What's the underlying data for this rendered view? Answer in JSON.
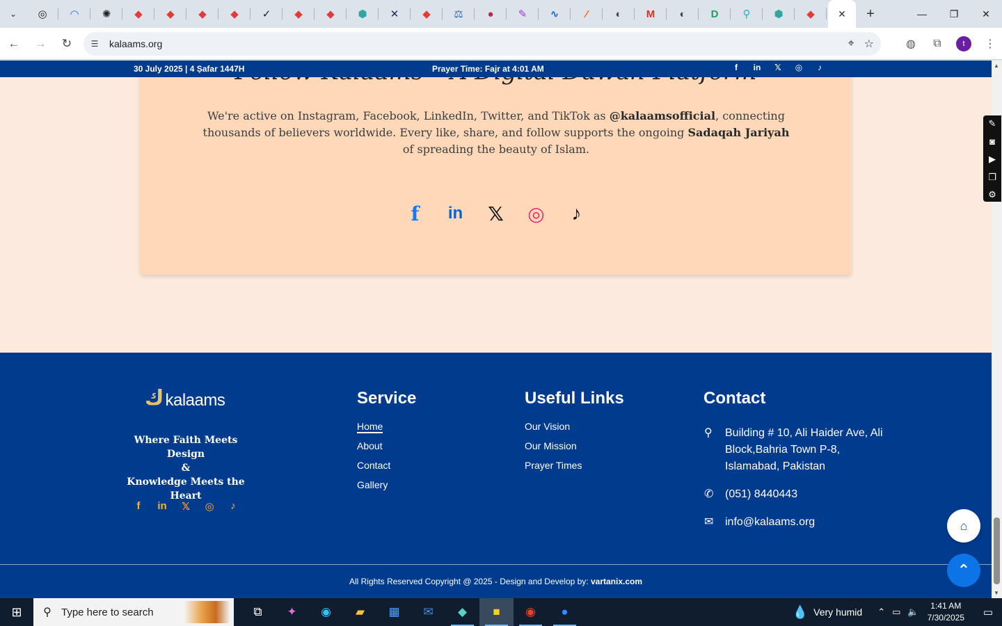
{
  "browser": {
    "tabs": [
      {
        "icon": "chevron-down-icon",
        "color": "#333333",
        "glyph": "⌄"
      },
      {
        "icon": "target-icon",
        "color": "#1f1f1f",
        "glyph": "◎"
      },
      {
        "icon": "arc-icon",
        "color": "#2b6fe0",
        "glyph": "◠"
      },
      {
        "icon": "chatgpt-icon",
        "color": "#222222",
        "glyph": "✺"
      },
      {
        "icon": "red-diamond-icon",
        "color": "#e23b3b",
        "glyph": "◆"
      },
      {
        "icon": "red-diamond-icon",
        "color": "#e23b3b",
        "glyph": "◆"
      },
      {
        "icon": "red-diamond-icon",
        "color": "#e23b3b",
        "glyph": "◆"
      },
      {
        "icon": "red-diamond-icon",
        "color": "#e23b3b",
        "glyph": "◆"
      },
      {
        "icon": "checkmark-icon",
        "color": "#222222",
        "glyph": "✓"
      },
      {
        "icon": "red-diamond-icon",
        "color": "#e23b3b",
        "glyph": "◆"
      },
      {
        "icon": "red-diamond-icon",
        "color": "#e23b3b",
        "glyph": "◆"
      },
      {
        "icon": "hexagon-icon",
        "color": "#2fa7a0",
        "glyph": "⬢"
      },
      {
        "icon": "x-cross-icon",
        "color": "#1c2a5a",
        "glyph": "✕"
      },
      {
        "icon": "red-diamond-icon",
        "color": "#e23b3b",
        "glyph": "◆"
      },
      {
        "icon": "scales-icon",
        "color": "#2a63b8",
        "glyph": "⚖"
      },
      {
        "icon": "ball-icon",
        "color": "#b42b56",
        "glyph": "●"
      },
      {
        "icon": "pencil-icon",
        "color": "#9a3bd0",
        "glyph": "✎"
      },
      {
        "icon": "pulse-icon",
        "color": "#1565c0",
        "glyph": "∿"
      },
      {
        "icon": "slash-icon",
        "color": "#e85d20",
        "glyph": "⁄"
      },
      {
        "icon": "globe-icon",
        "color": "#444444",
        "glyph": "◐"
      },
      {
        "icon": "gmail-icon",
        "color": "#d93025",
        "glyph": "M"
      },
      {
        "icon": "globe-icon",
        "color": "#444444",
        "glyph": "◐"
      },
      {
        "icon": "d-letter-icon",
        "color": "#1aa260",
        "glyph": "D"
      },
      {
        "icon": "search-circle-icon",
        "color": "#18b4c9",
        "glyph": "⚲"
      },
      {
        "icon": "hexagon-icon",
        "color": "#2fa7a0",
        "glyph": "⬢"
      },
      {
        "icon": "red-diamond-icon",
        "color": "#e23b3b",
        "glyph": "◆"
      }
    ],
    "url": "kalaams.org"
  },
  "topbar": {
    "date": "30 July 2025 | 4 Ṣafar 1447H",
    "prayer": "Prayer Time: Fajr at 4:01 AM"
  },
  "follow": {
    "title": "Follow Kalaams – A Digital Dawah Platform",
    "desc_1": "We're active on Instagram, Facebook, LinkedIn, Twitter, and TikTok as ",
    "handle": "@kalaamsofficial",
    "desc_2": ", connecting thousands of believers worldwide. Every like, share, and follow supports the ongoing ",
    "sadaqah": "Sadaqah Jariyah",
    "desc_3": " of spreading the beauty of Islam."
  },
  "footer": {
    "logo_text": "kalaams",
    "tagline_1": "Where Faith Meets Design",
    "tagline_2": "&",
    "tagline_3": "Knowledge Meets the Heart",
    "service": {
      "title": "Service",
      "links": [
        "Home",
        "About",
        "Contact",
        "Gallery"
      ]
    },
    "useful": {
      "title": "Useful Links",
      "links": [
        "Our Vision",
        "Our Mission",
        "Prayer Times"
      ]
    },
    "contact": {
      "title": "Contact",
      "address": "Building # 10, Ali Haider Ave, Ali Block,Bahria Town P-8, Islamabad, Pakistan",
      "phone": "(051) 8440443",
      "email": "info@kalaams.org"
    },
    "copyright": "All Rights Reserved Copyright @ 2025 - Design and Develop by: ",
    "developer": "vartanix.com"
  },
  "taskbar": {
    "search_placeholder": "Type here to search",
    "weather": "Very humid",
    "time": "1:41 AM",
    "date": "7/30/2025"
  },
  "colors": {
    "brand_blue": "#003b8e",
    "card_peach": "#fed8b8",
    "accent_gold": "#f3b43b"
  }
}
